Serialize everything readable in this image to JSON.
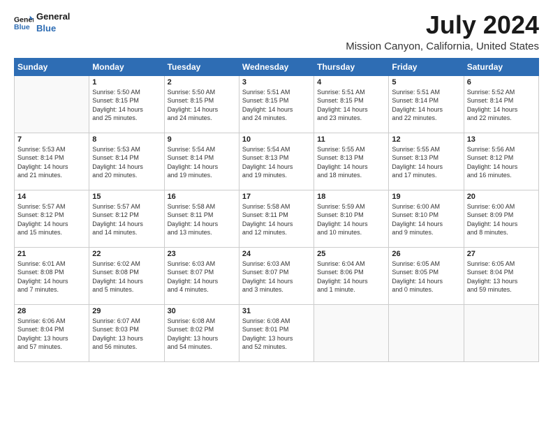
{
  "logo": {
    "line1": "General",
    "line2": "Blue"
  },
  "header": {
    "month": "July 2024",
    "location": "Mission Canyon, California, United States"
  },
  "weekdays": [
    "Sunday",
    "Monday",
    "Tuesday",
    "Wednesday",
    "Thursday",
    "Friday",
    "Saturday"
  ],
  "weeks": [
    [
      {
        "day": "",
        "info": ""
      },
      {
        "day": "1",
        "info": "Sunrise: 5:50 AM\nSunset: 8:15 PM\nDaylight: 14 hours\nand 25 minutes."
      },
      {
        "day": "2",
        "info": "Sunrise: 5:50 AM\nSunset: 8:15 PM\nDaylight: 14 hours\nand 24 minutes."
      },
      {
        "day": "3",
        "info": "Sunrise: 5:51 AM\nSunset: 8:15 PM\nDaylight: 14 hours\nand 24 minutes."
      },
      {
        "day": "4",
        "info": "Sunrise: 5:51 AM\nSunset: 8:15 PM\nDaylight: 14 hours\nand 23 minutes."
      },
      {
        "day": "5",
        "info": "Sunrise: 5:51 AM\nSunset: 8:14 PM\nDaylight: 14 hours\nand 22 minutes."
      },
      {
        "day": "6",
        "info": "Sunrise: 5:52 AM\nSunset: 8:14 PM\nDaylight: 14 hours\nand 22 minutes."
      }
    ],
    [
      {
        "day": "7",
        "info": "Sunrise: 5:53 AM\nSunset: 8:14 PM\nDaylight: 14 hours\nand 21 minutes."
      },
      {
        "day": "8",
        "info": "Sunrise: 5:53 AM\nSunset: 8:14 PM\nDaylight: 14 hours\nand 20 minutes."
      },
      {
        "day": "9",
        "info": "Sunrise: 5:54 AM\nSunset: 8:14 PM\nDaylight: 14 hours\nand 19 minutes."
      },
      {
        "day": "10",
        "info": "Sunrise: 5:54 AM\nSunset: 8:13 PM\nDaylight: 14 hours\nand 19 minutes."
      },
      {
        "day": "11",
        "info": "Sunrise: 5:55 AM\nSunset: 8:13 PM\nDaylight: 14 hours\nand 18 minutes."
      },
      {
        "day": "12",
        "info": "Sunrise: 5:55 AM\nSunset: 8:13 PM\nDaylight: 14 hours\nand 17 minutes."
      },
      {
        "day": "13",
        "info": "Sunrise: 5:56 AM\nSunset: 8:12 PM\nDaylight: 14 hours\nand 16 minutes."
      }
    ],
    [
      {
        "day": "14",
        "info": "Sunrise: 5:57 AM\nSunset: 8:12 PM\nDaylight: 14 hours\nand 15 minutes."
      },
      {
        "day": "15",
        "info": "Sunrise: 5:57 AM\nSunset: 8:12 PM\nDaylight: 14 hours\nand 14 minutes."
      },
      {
        "day": "16",
        "info": "Sunrise: 5:58 AM\nSunset: 8:11 PM\nDaylight: 14 hours\nand 13 minutes."
      },
      {
        "day": "17",
        "info": "Sunrise: 5:58 AM\nSunset: 8:11 PM\nDaylight: 14 hours\nand 12 minutes."
      },
      {
        "day": "18",
        "info": "Sunrise: 5:59 AM\nSunset: 8:10 PM\nDaylight: 14 hours\nand 10 minutes."
      },
      {
        "day": "19",
        "info": "Sunrise: 6:00 AM\nSunset: 8:10 PM\nDaylight: 14 hours\nand 9 minutes."
      },
      {
        "day": "20",
        "info": "Sunrise: 6:00 AM\nSunset: 8:09 PM\nDaylight: 14 hours\nand 8 minutes."
      }
    ],
    [
      {
        "day": "21",
        "info": "Sunrise: 6:01 AM\nSunset: 8:08 PM\nDaylight: 14 hours\nand 7 minutes."
      },
      {
        "day": "22",
        "info": "Sunrise: 6:02 AM\nSunset: 8:08 PM\nDaylight: 14 hours\nand 5 minutes."
      },
      {
        "day": "23",
        "info": "Sunrise: 6:03 AM\nSunset: 8:07 PM\nDaylight: 14 hours\nand 4 minutes."
      },
      {
        "day": "24",
        "info": "Sunrise: 6:03 AM\nSunset: 8:07 PM\nDaylight: 14 hours\nand 3 minutes."
      },
      {
        "day": "25",
        "info": "Sunrise: 6:04 AM\nSunset: 8:06 PM\nDaylight: 14 hours\nand 1 minute."
      },
      {
        "day": "26",
        "info": "Sunrise: 6:05 AM\nSunset: 8:05 PM\nDaylight: 14 hours\nand 0 minutes."
      },
      {
        "day": "27",
        "info": "Sunrise: 6:05 AM\nSunset: 8:04 PM\nDaylight: 13 hours\nand 59 minutes."
      }
    ],
    [
      {
        "day": "28",
        "info": "Sunrise: 6:06 AM\nSunset: 8:04 PM\nDaylight: 13 hours\nand 57 minutes."
      },
      {
        "day": "29",
        "info": "Sunrise: 6:07 AM\nSunset: 8:03 PM\nDaylight: 13 hours\nand 56 minutes."
      },
      {
        "day": "30",
        "info": "Sunrise: 6:08 AM\nSunset: 8:02 PM\nDaylight: 13 hours\nand 54 minutes."
      },
      {
        "day": "31",
        "info": "Sunrise: 6:08 AM\nSunset: 8:01 PM\nDaylight: 13 hours\nand 52 minutes."
      },
      {
        "day": "",
        "info": ""
      },
      {
        "day": "",
        "info": ""
      },
      {
        "day": "",
        "info": ""
      }
    ]
  ]
}
